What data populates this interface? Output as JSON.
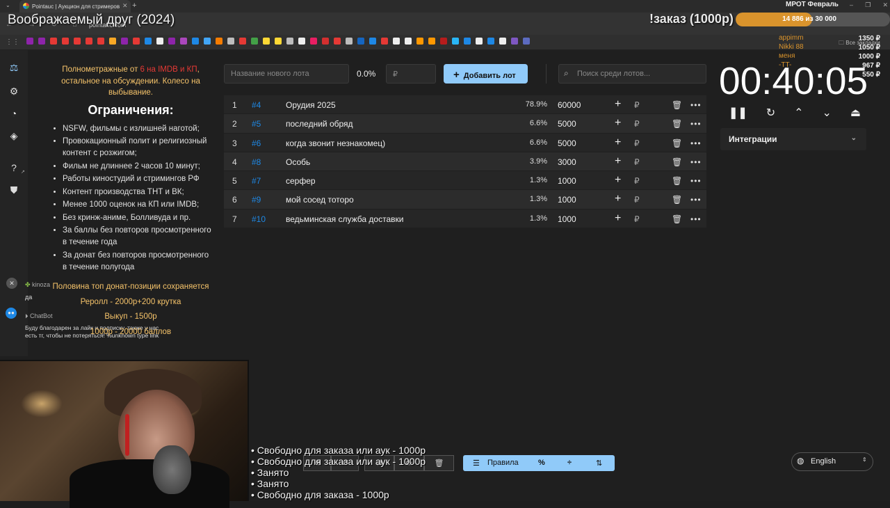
{
  "browser": {
    "tab_title": "Pointauc | Аукцион для стримеров",
    "url": "pointauc.com",
    "bookmarks_all": "Все закладки",
    "bookmark_colors": [
      "#8e24aa",
      "#8e24aa",
      "#e53935",
      "#e53935",
      "#e53935",
      "#e53935",
      "#e53935",
      "#f9a825",
      "#8e24aa",
      "#e53935",
      "#1e88e5",
      "#eeeeee",
      "#8e24aa",
      "#ab47bc",
      "#1e88e5",
      "#42a5f5",
      "#f57c00",
      "#bdbdbd",
      "#e53935",
      "#43a047",
      "#fdd835",
      "#fdd835",
      "#bdbdbd",
      "#eeeeee",
      "#e91e63",
      "#d32f2f",
      "#e53935",
      "#bdbdbd",
      "#1565c0",
      "#1e88e5",
      "#e53935",
      "#eeeeee",
      "#eeeeee",
      "#ff9800",
      "#ff9800",
      "#b71c1c",
      "#29b6f6",
      "#1e88e5",
      "#eeeeee",
      "#1e88e5",
      "#eeeeee",
      "#7e57c2",
      "#5c6bc0"
    ]
  },
  "overlay": {
    "stream_title": "Воображаемый друг (2024)",
    "mrot_label": "МРОТ Февраль",
    "order_label": "!заказ (1000р)",
    "goal_text": "14 886  из 30 000",
    "goal_fraction": 0.496,
    "donors": [
      {
        "name": "appimm",
        "amount": "1350 ₽"
      },
      {
        "name": "Nikki 88",
        "amount": "1050 ₽"
      },
      {
        "name": "меня",
        "amount": "1000 ₽"
      },
      {
        "name": "-TT-",
        "amount": "967 ₽"
      },
      {
        "name": "",
        "amount": "550 ₽"
      }
    ],
    "status_list": [
      "Свободно для заказа или аук - 1000р",
      "Свободно для заказа или аук - 1000р",
      "Занято",
      "Занято",
      "Свободно для заказа - 1000р"
    ]
  },
  "rules": {
    "intro_part1": "Полнометражные от ",
    "intro_red": "6 на IMDB и КП",
    "intro_part2": ", остальное на обсуждении. Колесо на выбывание.",
    "heading": "Ограничения:",
    "items": [
      "NSFW, фильмы с излишней наготой;",
      "Провокационный полит и религиозный контент с розжигом;",
      "Фильм не длиннее 2 часов 10 минут;",
      "Работы киностудий и стримингов РФ",
      "Контент производства ТНТ и ВК;",
      "Менее 1000 оценок на КП или IMDB;",
      "Без кринж-аниме, Болливуда и пр.",
      "За баллы без повторов просмотренного в течение года",
      "За донат без повторов просмотренного в течение полугода"
    ],
    "bottom": [
      "Половина топ донат-позиции сохраняется",
      "Реролл - 2000р+200 крутка",
      "Выкуп - 1500р",
      "1000р - 20000 баллов"
    ]
  },
  "chat": {
    "user1": "kinoza",
    "msg1": "да",
    "user2": "ChatBot",
    "msg2": "Буду благодарен за лайк и подписку, также у нас есть тг, чтобы не потеряться! %unknown type link"
  },
  "controls": {
    "new_lot_placeholder": "Название нового лота",
    "percent_total": "0.0%",
    "amount_placeholder": "₽",
    "add_button": "Добавить лот",
    "search_placeholder": "Поиск среди лотов..."
  },
  "lots": [
    {
      "num": "1",
      "id": "#4",
      "name": "Орудия 2025",
      "pct": "78.9%",
      "amount": "60000"
    },
    {
      "num": "2",
      "id": "#5",
      "name": "последний обряд",
      "pct": "6.6%",
      "amount": "5000"
    },
    {
      "num": "3",
      "id": "#6",
      "name": "когда звонит незнакомец)",
      "pct": "6.6%",
      "amount": "5000"
    },
    {
      "num": "4",
      "id": "#8",
      "name": "Особь",
      "pct": "3.9%",
      "amount": "3000"
    },
    {
      "num": "5",
      "id": "#7",
      "name": "серфер",
      "pct": "1.3%",
      "amount": "1000"
    },
    {
      "num": "6",
      "id": "#9",
      "name": "мой сосед тоторо",
      "pct": "1.3%",
      "amount": "1000"
    },
    {
      "num": "7",
      "id": "#10",
      "name": "ведьминская служба доставки",
      "pct": "1.3%",
      "amount": "1000"
    }
  ],
  "timer": {
    "value": "00:40:05",
    "integrations_label": "Интеграции"
  },
  "toolbar": {
    "rules_label": "Правила",
    "percent_icon": "%"
  },
  "language": {
    "selected": "English"
  }
}
